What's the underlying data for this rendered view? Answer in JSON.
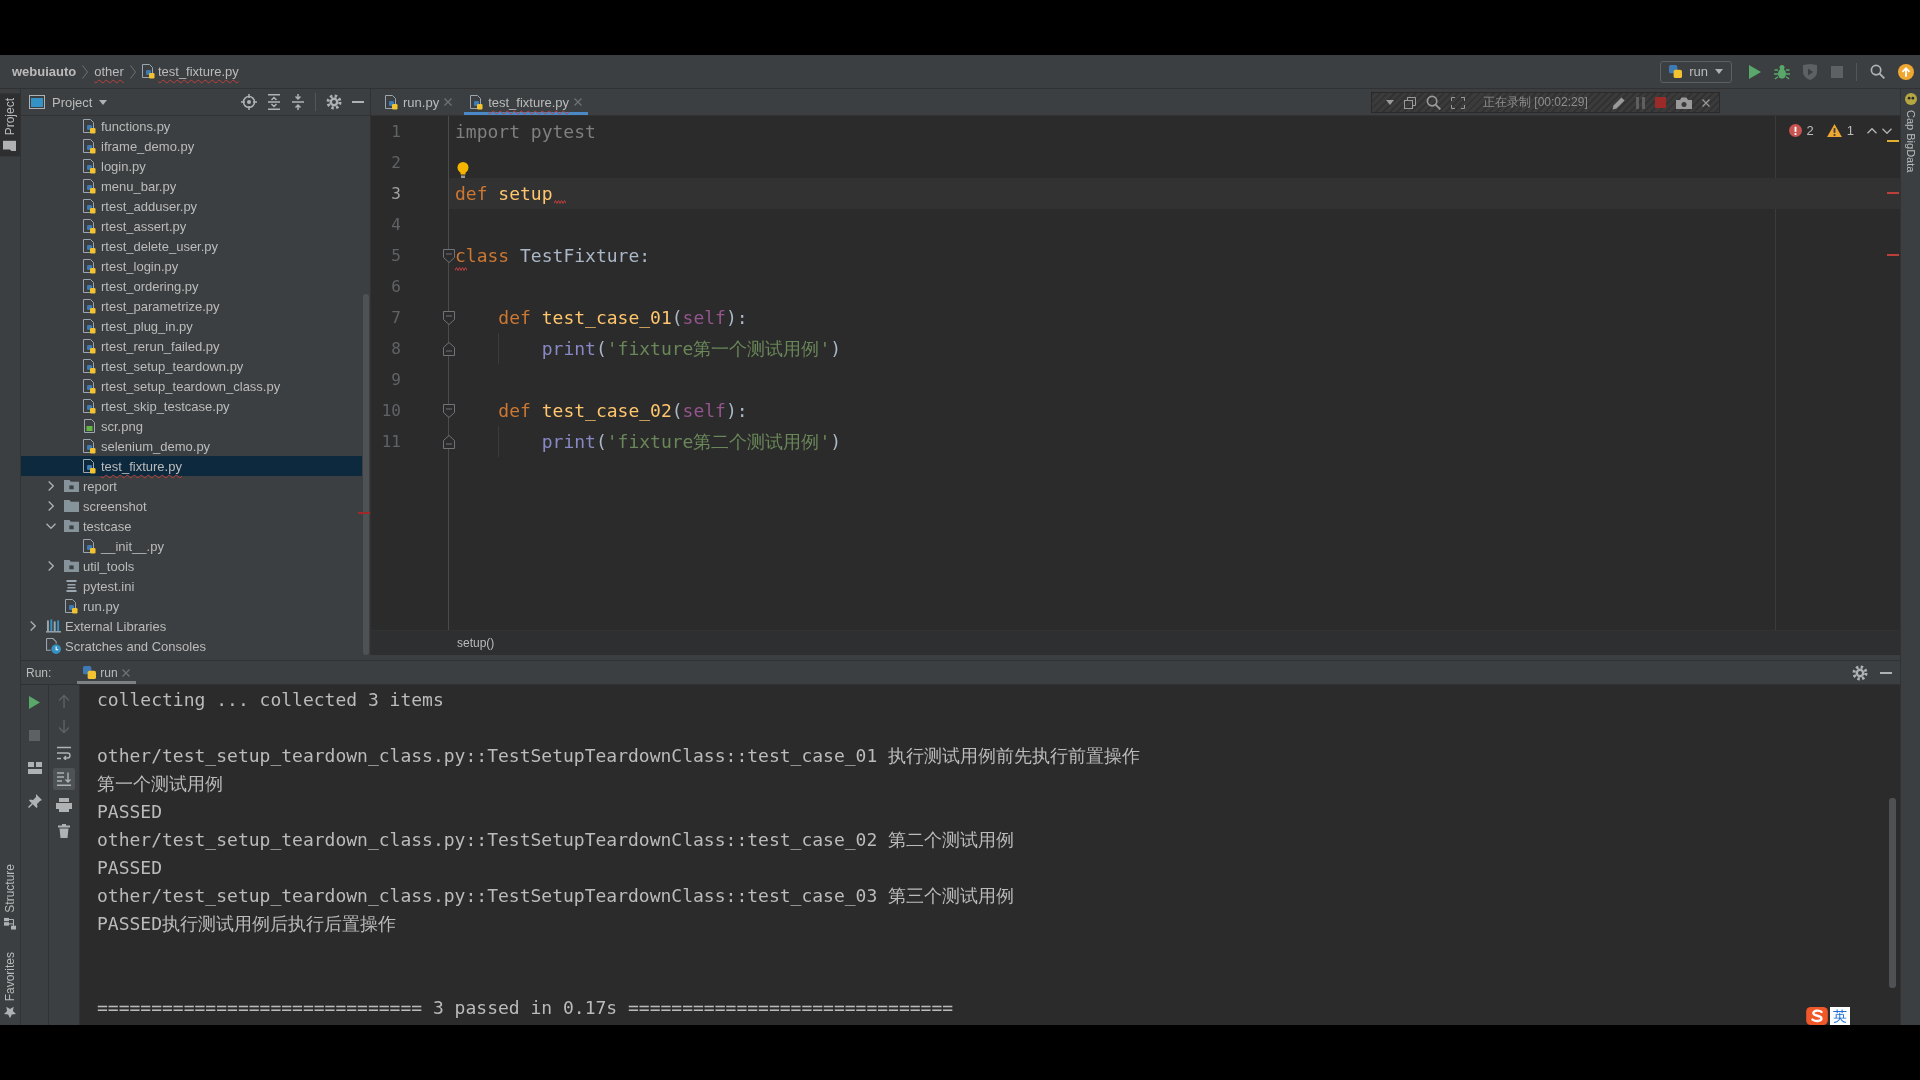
{
  "navigation_bar": {
    "breadcrumbs": [
      {
        "label": "webuiauto",
        "kind": "project",
        "error": false
      },
      {
        "label": "other",
        "kind": "folder",
        "error": true
      },
      {
        "label": "test_fixture.py",
        "kind": "python",
        "error": true
      }
    ],
    "run_configuration": {
      "label": "run"
    },
    "actions": [
      {
        "kind": "run",
        "disabled": false
      },
      {
        "kind": "debug",
        "disabled": false
      },
      {
        "kind": "coverage",
        "disabled": true
      },
      {
        "kind": "stop",
        "disabled": true
      },
      {
        "kind": "search",
        "disabled": false
      },
      {
        "kind": "update",
        "disabled": false
      }
    ]
  },
  "left_tool_strip": {
    "top": [
      {
        "label": "Project",
        "kind": "project",
        "selected": true
      }
    ],
    "bottom": [
      {
        "label": "Structure",
        "kind": "structure",
        "selected": false
      },
      {
        "label": "Favorites",
        "kind": "favorites",
        "selected": false
      }
    ]
  },
  "project_panel": {
    "title": "Project",
    "tree": [
      {
        "children": [
          {
            "children": [
              {
                "label": "functions.py",
                "kind": "python",
                "selected": false,
                "error": false
              },
              {
                "label": "iframe_demo.py",
                "kind": "python",
                "selected": false,
                "error": false
              },
              {
                "label": "login.py",
                "kind": "python",
                "selected": false,
                "error": false
              },
              {
                "label": "menu_bar.py",
                "kind": "python",
                "selected": false,
                "error": false
              },
              {
                "label": "rtest_adduser.py",
                "kind": "python",
                "selected": false,
                "error": false
              },
              {
                "label": "rtest_assert.py",
                "kind": "python",
                "selected": false,
                "error": false
              },
              {
                "label": "rtest_delete_user.py",
                "kind": "python",
                "selected": false,
                "error": false
              },
              {
                "label": "rtest_login.py",
                "kind": "python",
                "selected": false,
                "error": false
              },
              {
                "label": "rtest_ordering.py",
                "kind": "python",
                "selected": false,
                "error": false
              },
              {
                "label": "rtest_parametrize.py",
                "kind": "python",
                "selected": false,
                "error": false
              },
              {
                "label": "rtest_plug_in.py",
                "kind": "python",
                "selected": false,
                "error": false
              },
              {
                "label": "rtest_rerun_failed.py",
                "kind": "python",
                "selected": false,
                "error": false
              },
              {
                "label": "rtest_setup_teardown.py",
                "kind": "python",
                "selected": false,
                "error": false
              },
              {
                "label": "rtest_setup_teardown_class.py",
                "kind": "python",
                "selected": false,
                "error": false
              },
              {
                "label": "rtest_skip_testcase.py",
                "kind": "python",
                "selected": false,
                "error": false
              },
              {
                "label": "scr.png",
                "kind": "image",
                "selected": false,
                "error": false
              },
              {
                "label": "selenium_demo.py",
                "kind": "python",
                "selected": false,
                "error": false
              },
              {
                "label": "test_fixture.py",
                "kind": "python",
                "selected": true,
                "error": true
              }
            ]
          },
          {
            "label": "report",
            "kind": "package",
            "expanded": false,
            "selected": false,
            "error": false
          },
          {
            "label": "screenshot",
            "kind": "folder",
            "expanded": false,
            "selected": false,
            "error": false
          },
          {
            "label": "testcase",
            "kind": "package",
            "expanded": true,
            "selected": false,
            "error": false,
            "children": [
              {
                "label": "__init__.py",
                "kind": "python",
                "selected": false,
                "error": false
              }
            ]
          },
          {
            "label": "util_tools",
            "kind": "package",
            "expanded": false,
            "selected": false,
            "error": false
          },
          {
            "label": "pytest.ini",
            "kind": "ini",
            "selected": false,
            "error": false
          },
          {
            "label": "run.py",
            "kind": "python",
            "selected": false,
            "error": false
          }
        ]
      },
      {
        "label": "External Libraries",
        "kind": "libraries",
        "expanded": false,
        "selected": false,
        "error": false
      },
      {
        "label": "Scratches and Consoles",
        "kind": "scratches",
        "selected": false,
        "error": false
      }
    ]
  },
  "editor": {
    "tabs": [
      {
        "label": "run.py",
        "selected": false,
        "error": false
      },
      {
        "label": "test_fixture.py",
        "selected": true,
        "error": true
      }
    ],
    "lines": [
      {
        "number": "1",
        "current": false,
        "tokens": [
          {
            "kind": "unused",
            "text": "import pytest"
          }
        ]
      },
      {
        "number": "2",
        "current": false,
        "bulb": true
      },
      {
        "number": "3",
        "current": true,
        "error_at_end": true,
        "tokens": [
          {
            "kind": "keyword",
            "text": "def"
          },
          {
            "kind": "function",
            "text": " setup"
          }
        ]
      },
      {
        "number": "4",
        "current": false
      },
      {
        "number": "5",
        "current": false,
        "fold_start": true,
        "tokens": [
          {
            "kind": "keyword",
            "text": "class",
            "error": true
          },
          {
            "kind": "plain",
            "text": " TestFixture:"
          }
        ]
      },
      {
        "number": "6",
        "current": false
      },
      {
        "number": "7",
        "current": false,
        "fold_start": true,
        "tokens": [
          {
            "kind": "keyword",
            "text": "    def"
          },
          {
            "kind": "function",
            "text": " test_case_01"
          },
          {
            "kind": "plain",
            "text": "("
          },
          {
            "kind": "self",
            "text": "self"
          },
          {
            "kind": "plain",
            "text": "):"
          }
        ]
      },
      {
        "number": "8",
        "current": false,
        "fold_end": true,
        "tokens": [
          {
            "kind": "builtin",
            "text": "        print"
          },
          {
            "kind": "plain",
            "text": "("
          },
          {
            "kind": "string",
            "text": "'fixture第一个测试用例'"
          },
          {
            "kind": "plain",
            "text": ")"
          }
        ]
      },
      {
        "number": "9",
        "current": false
      },
      {
        "number": "10",
        "current": false,
        "fold_start": true,
        "tokens": [
          {
            "kind": "keyword",
            "text": "    def"
          },
          {
            "kind": "function",
            "text": " test_case_02"
          },
          {
            "kind": "plain",
            "text": "("
          },
          {
            "kind": "self",
            "text": "self"
          },
          {
            "kind": "plain",
            "text": "):"
          }
        ]
      },
      {
        "number": "11",
        "current": false,
        "fold_end": true,
        "tokens": [
          {
            "kind": "builtin",
            "text": "        print"
          },
          {
            "kind": "plain",
            "text": "("
          },
          {
            "kind": "string",
            "text": "'fixture第二个测试用例'"
          },
          {
            "kind": "plain",
            "text": ")"
          }
        ]
      }
    ],
    "inspections": {
      "errors": "2",
      "warnings": "1"
    },
    "breadcrumb": "setup()"
  },
  "screen_recorder": {
    "status": "正在录制 [00:02:29]"
  },
  "run_panel": {
    "title": "Run:",
    "tabs": [
      {
        "label": "run",
        "selected": true
      }
    ],
    "primary_toolbar": [
      {
        "kind": "rerun",
        "disabled": false
      },
      {
        "kind": "stop",
        "disabled": true
      },
      {
        "kind": "layout",
        "disabled": false
      },
      {
        "kind": "pin",
        "disabled": false
      }
    ],
    "secondary_toolbar": [
      {
        "kind": "up",
        "disabled": true
      },
      {
        "kind": "down",
        "disabled": true
      },
      {
        "kind": "soft-wrap",
        "disabled": false,
        "on": false
      },
      {
        "kind": "scroll-to-end",
        "disabled": false,
        "on": true
      },
      {
        "kind": "print",
        "disabled": false
      },
      {
        "kind": "clear",
        "disabled": false
      }
    ],
    "console": [
      {
        "kind": "text",
        "text": "collecting ... collected 3 items"
      },
      {
        "kind": "blank"
      },
      {
        "kind": "text",
        "text": "other/test_setup_teardown_class.py::TestSetupTeardownClass::test_case_01 执行测试用例前先执行前置操作"
      },
      {
        "kind": "text",
        "text": "第一个测试用例"
      },
      {
        "kind": "text",
        "text": "PASSED"
      },
      {
        "kind": "text",
        "text": "other/test_setup_teardown_class.py::TestSetupTeardownClass::test_case_02 第二个测试用例"
      },
      {
        "kind": "text",
        "text": "PASSED"
      },
      {
        "kind": "text",
        "text": "other/test_setup_teardown_class.py::TestSetupTeardownClass::test_case_03 第三个测试用例"
      },
      {
        "kind": "text",
        "text": "PASSED执行测试用例后执行后置操作"
      },
      {
        "kind": "blank"
      },
      {
        "kind": "blank"
      },
      {
        "kind": "text",
        "text": "============================== 3 passed in 0.17s =============================="
      }
    ]
  },
  "right_tool_strip": [
    {
      "label": "Cap BigData"
    }
  ],
  "input_method": {
    "mode": "英"
  }
}
